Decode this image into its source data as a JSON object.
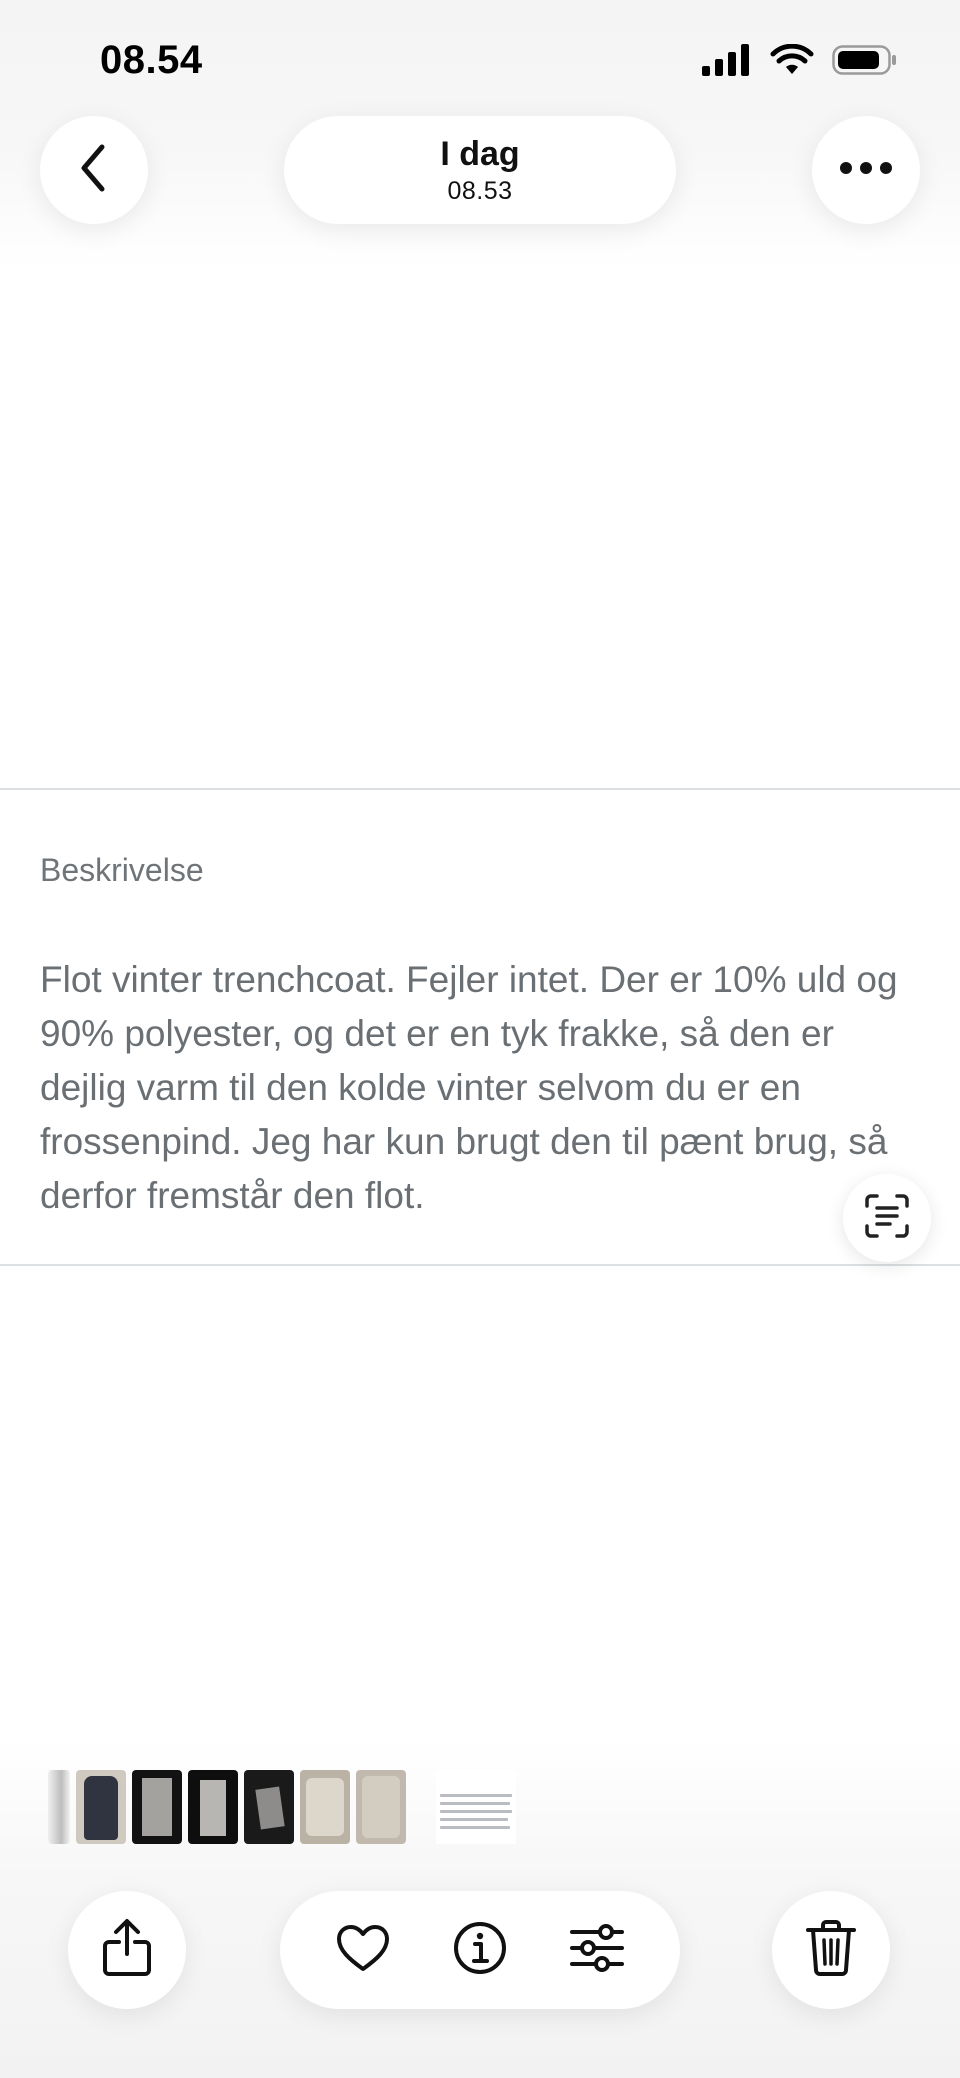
{
  "status": {
    "time": "08.54",
    "icons": [
      "signal-icon",
      "wifi-icon",
      "battery-icon"
    ]
  },
  "nav": {
    "back_icon": "chevron-left-icon",
    "title": "I dag",
    "subtitle": "08.53",
    "more_icon": "ellipsis-icon"
  },
  "photo": {
    "label": "Beskrivelse",
    "description": "Flot vinter trenchcoat. Fejler intet. Der er 10% uld og 90% polyester, og det er en tyk frakke, så den er dejlig varm til den kolde vinter selvom du er en frossenpind. Jeg har kun brugt den til pænt brug, så derfor fremstår den flot.",
    "live_text_icon": "live-text-icon"
  },
  "thumbnails": {
    "colors": [
      "#d9d9d9",
      "#2f3440",
      "#9a9a98",
      "#b7b6b2",
      "#8d8c8a",
      "#d8d2c6",
      "#cdc6bb"
    ],
    "selected": "description-screenshot"
  },
  "toolbar": {
    "items": [
      "share-icon",
      "heart-icon",
      "info-icon",
      "adjust-icon",
      "trash-icon"
    ]
  },
  "colors": {
    "background": "#ffffff",
    "text_gray": "#6a6f74",
    "divider": "#dde0e2"
  }
}
